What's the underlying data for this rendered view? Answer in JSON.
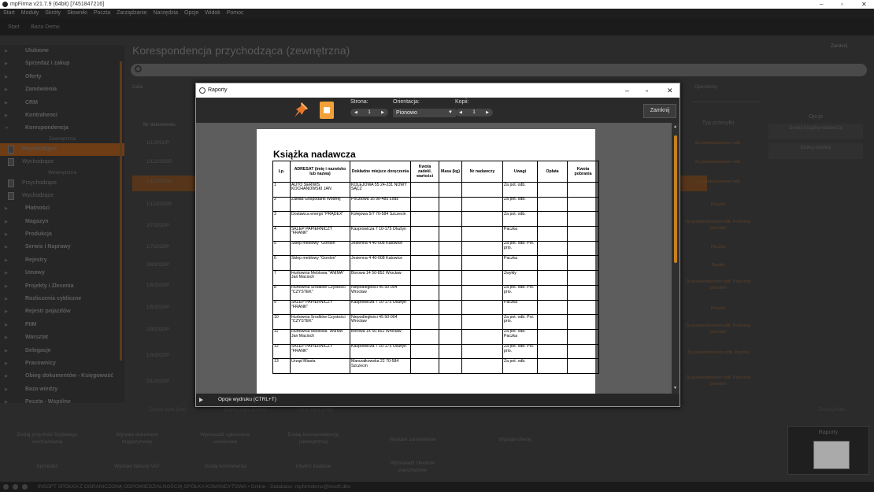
{
  "app": {
    "title": "mpFirma v21.7.9 (64bit) [7451847216]",
    "win_min": "–",
    "win_max": "▫",
    "win_close": "✕"
  },
  "menu": [
    "Start",
    "Moduły",
    "Skróty",
    "Słowniki",
    "Poczta",
    "Zarządzanie",
    "Narzędzia",
    "Opcje",
    "Widok",
    "Pomoc"
  ],
  "tabs": [
    "Start",
    "Baza Demo"
  ],
  "sidebar": {
    "items": [
      {
        "label": "Ulubione"
      },
      {
        "label": "Sprzedaż i zakup"
      },
      {
        "label": "Oferty"
      },
      {
        "label": "Zamówienia"
      },
      {
        "label": "CRM"
      },
      {
        "label": "Kontrahenci"
      },
      {
        "label": "Korespondencja"
      }
    ],
    "group_external": "Zewnętrzna",
    "doc_incoming": "Przychodzące",
    "doc_outgoing": "Wychodzące",
    "group_internal": "Wewnętrzna",
    "doc_incoming2": "Przychodzące",
    "doc_outgoing2": "Wychodzące",
    "lower_items": [
      {
        "label": "Płatności"
      },
      {
        "label": "Magazyn"
      },
      {
        "label": "Produkcja"
      },
      {
        "label": "Serwis i Naprawy"
      },
      {
        "label": "Rejestry"
      },
      {
        "label": "Umowy"
      },
      {
        "label": "Projekty i Zlecenia"
      },
      {
        "label": "Rozliczenia cykliczne"
      },
      {
        "label": "Rejestr pojazdów"
      },
      {
        "label": "PIIM"
      },
      {
        "label": "Warsztat"
      },
      {
        "label": "Delegacje"
      },
      {
        "label": "Pracownicy"
      },
      {
        "label": "Obieg dokumentów - Księgowość"
      },
      {
        "label": "Baza wiedzy"
      },
      {
        "label": "Poczta - Wspólne"
      }
    ]
  },
  "main": {
    "title": "Korespondencja przychodząca (zewnętrzna)",
    "close": "Zamknij",
    "filter_date": "Data:",
    "filter_operator": "Operatorzy",
    "col_doc": "Nr dokumentu",
    "col_type": "Typ przesyłki",
    "dates": [
      "1/1/2021/P",
      "1/12/2020/P",
      "1/12/2020/P",
      "1/12/2020/P",
      "2/7/2020/P",
      "1/7/2020/P",
      "2/6/2020/P",
      "1/6/2020/P",
      "1/5/2020/P",
      "2/3/2020/P",
      "1/3/2020/P",
      "2/1/2020/P"
    ],
    "types": [
      "Za potwierdzeniem odb.",
      "Za potwierdzeniem odb.",
      "Za potwierdzeniem odb.",
      "Paczka",
      "Za potwierdzeniem odb. Polecony priorytet",
      "Paczka",
      "Zwykły",
      "Za potwierdzeniem odb. Polecony priorytet",
      "Paczka",
      "Za potwierdzeniem odb. Polecony priorytet",
      "Za potwierdzeniem odb. Paczka",
      "Za potwierdzeniem odb. Polecony priorytet"
    ],
    "add": "Dodaj wpis [Ins]",
    "edit": "Edytuj wpis [Enter]",
    "delete": "Usuń wpis [Del]",
    "print_list": "Drukuj listę"
  },
  "options": {
    "title": "Opcje",
    "btn1": "Drukuj książkę nadawczą",
    "btn2": "Drukuj etykiety"
  },
  "bottom": {
    "row1": [
      "Dodaj przychód Szybkiego uruchamiania",
      "Wystaw dokument magazynowy",
      "Wprowadź zgłoszenie serwisowe",
      "Dodaj korespondencję (zewnętrzna)",
      "Wystaw zamówienie",
      "Wystaw ofertę"
    ],
    "row2": [
      "Sprzedaż",
      "Wystaw fakturę VAT",
      "Dodaj kontrahenta",
      "Utwórz zadanie",
      "Wprowadź zlecenie warsztatowe"
    ],
    "reports": "Raporty"
  },
  "status": "INSOFT SPÓŁKA Z OGRANICZONĄ ODPOWIEDZIALNOŚCIĄ SPÓŁKA KOMANDYTOWA • Online - Database: mpfirmdemo@insoft.dbs",
  "dialog": {
    "title": "Raporty",
    "page_label": "Strona:",
    "page_value": "1",
    "orient_label": "Orientacja:",
    "orient_value": "Pionowo",
    "copies_label": "Kopii:",
    "copies_value": "1",
    "close_btn": "Zamknij",
    "footer": "Opcje wydruku (CTRL+T)"
  },
  "report": {
    "title": "Książka nadawcza",
    "headers": [
      "Lp.",
      "ADRESAT (imię i nazwisko lub nazwa)",
      "Dokładne miejsce doręczenia",
      "Kwota zadekl. wartości",
      "Masa (kg)",
      "Nr nadawczy",
      "Uwagi",
      "Opłata",
      "Kwota pobrania"
    ],
    "rows": [
      {
        "lp": "1",
        "name": "AUTO SERWIS KOCHANOWSKI JAN",
        "addr": "KOLEJOWA 55 24-231 NOWY SĄCZ",
        "notes": "Za pot. odb."
      },
      {
        "lp": "2",
        "name": "Zakład Gospodarki Wodnej",
        "addr": "Pocztowa 16 90-485 Łódź",
        "notes": "Za pot. odb."
      },
      {
        "lp": "3",
        "name": "Dostawca energii \"PRĄDEX\"",
        "addr": "Kolejowa 5/7 70-584 Szczecin",
        "notes": "Za pot. odb."
      },
      {
        "lp": "4",
        "name": "SKLEP PAPIERNICZY \"FRANK\"",
        "addr": "Kasprowicza 7 10-175 Olsztyn",
        "notes": "Paczka"
      },
      {
        "lp": "5",
        "name": "Sklep meblowy \"Gordon\"",
        "addr": "Jesienna 4 40-008 Katowice",
        "notes": "Za pot. odb. Pol. prio."
      },
      {
        "lp": "6",
        "name": "Sklep meblowy \"Gordon\"",
        "addr": "Jesienna 4 40-008 Katowice",
        "notes": "Paczka"
      },
      {
        "lp": "7",
        "name": "Hurtownia Meblowa \"ANIMA\" Jan Macioch",
        "addr": "Borowa 14 50-852 Wrocław",
        "notes": "Zwykły"
      },
      {
        "lp": "8",
        "name": "Hurtownia Środków Czystości \"CZYSTEK\"",
        "addr": "Niepodległości 45 50-004 Wrocław",
        "notes": "Za pot. odb. Pol. prio."
      },
      {
        "lp": "9",
        "name": "SKLEP PAPIERNICZY \"FRANK\"",
        "addr": "Kasprowicza 7 10-175 Olsztyn",
        "notes": "Paczka"
      },
      {
        "lp": "10",
        "name": "Hurtownia Środków Czystości \"CZYSTEK\"",
        "addr": "Niepodległości 45 50-004 Wrocław",
        "notes": "Za pot. odb. Pol. prio."
      },
      {
        "lp": "11",
        "name": "Hurtownia Meblowa \"ANIMA\" Jan Macioch",
        "addr": "Borowa 14 50-852 Wrocław",
        "notes": "Za pot. odb. Paczka"
      },
      {
        "lp": "12",
        "name": "SKLEP PAPIERNICZY \"FRANK\"",
        "addr": "Kasprowicza 7 10-175 Olsztyn",
        "notes": "Za pot. odb. Pol. prio."
      },
      {
        "lp": "13",
        "name": "Urząd Miasta",
        "addr": "Marszałkowska 22 70-584 Szczecin",
        "notes": "Za pot. odb."
      }
    ]
  }
}
